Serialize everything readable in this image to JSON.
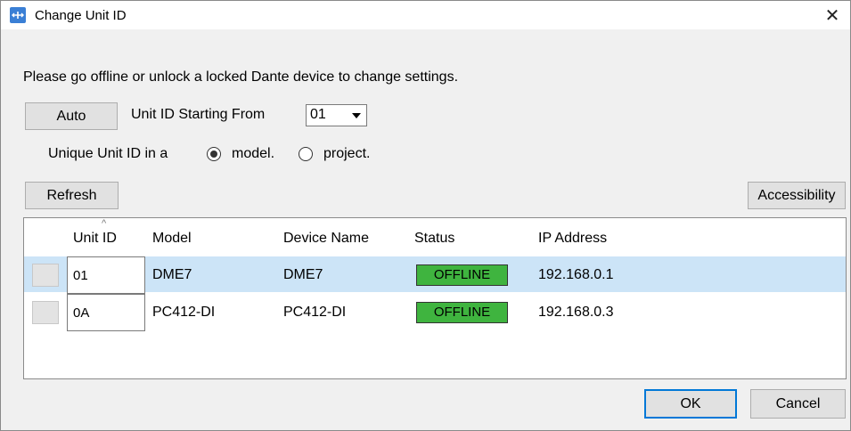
{
  "window": {
    "title": "Change Unit ID",
    "close_glyph": "✕"
  },
  "instruction": "Please go offline or unlock a locked Dante device to change settings.",
  "controls": {
    "auto_label": "Auto",
    "unit_id_start_label": "Unit ID Starting From",
    "unit_id_start_value": "01",
    "unique_label": "Unique Unit ID in a",
    "radio_model_label": "model.",
    "radio_project_label": "project.",
    "selected_scope": "model",
    "refresh_label": "Refresh",
    "accessibility_label": "Accessibility"
  },
  "table": {
    "sort_indicator": "^",
    "columns": [
      "Unit ID",
      "Model",
      "Device Name",
      "Status",
      "IP Address"
    ],
    "rows": [
      {
        "unit_id": "01",
        "model": "DME7",
        "device_name": "DME7",
        "status": "OFFLINE",
        "ip": "192.168.0.1",
        "selected": true
      },
      {
        "unit_id": "0A",
        "model": "PC412-DI",
        "device_name": "PC412-DI",
        "status": "OFFLINE",
        "ip": "192.168.0.3",
        "selected": false
      }
    ]
  },
  "footer": {
    "ok_label": "OK",
    "cancel_label": "Cancel"
  },
  "colors": {
    "status_offline": "#3fb43f",
    "selected_row": "#cce4f7",
    "accent": "#0078d7",
    "app_icon": "#3a7fd5"
  },
  "icons": {
    "app": "app-icon",
    "close": "close-icon",
    "dropdown": "chevron-down-icon"
  }
}
